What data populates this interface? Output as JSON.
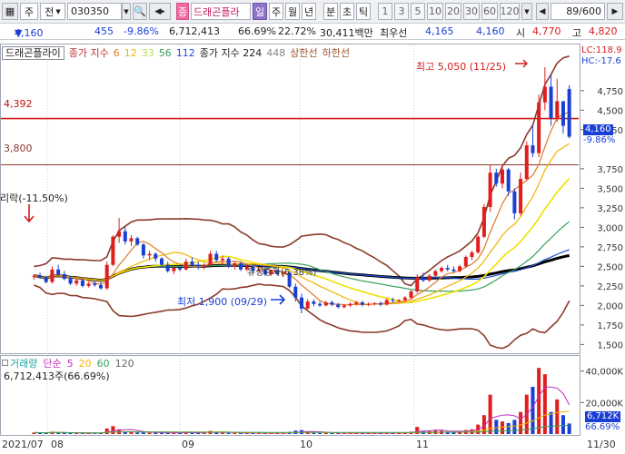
{
  "toolbar": {
    "menu_label": "주",
    "link_label": "전",
    "code": "030350",
    "view_toggle": "종",
    "stock_name": "드래곤플라",
    "day_label": "일",
    "week_label": "주",
    "month_label": "월",
    "year_label": "년",
    "minute_label": "분",
    "second_label": "초",
    "tick_label": "틱",
    "periods": [
      "1",
      "3",
      "5",
      "10",
      "20",
      "30",
      "60",
      "120"
    ],
    "count": "89/600"
  },
  "quote": {
    "price": "4,160",
    "change": "455",
    "change_rate": "-9.86%",
    "volume": "6,712,413",
    "volume_ratio": "66.69%",
    "turnover": "22.72%",
    "amount": "30,411백만",
    "best_label": "최우선",
    "ask": "4,165",
    "bid": "4,160",
    "open_label": "시",
    "open": "4,770",
    "high_label": "고",
    "high": "4,820"
  },
  "legend": {
    "name_box": "드래곤플라이",
    "price_label": "종가 지수",
    "ma": [
      "6",
      "12",
      "33",
      "56",
      "112"
    ],
    "ma_colors": [
      "#e07a2a",
      "#f0b400",
      "#b8e04a",
      "#3aa05a",
      "#1f4fd6"
    ],
    "index_label": "종가 지수",
    "index_val": "224",
    "index_val2": "448",
    "upper": "상한선",
    "lower": "하한선"
  },
  "right_tags": {
    "lc": "LC:118.9",
    "hc": "HC:-17.6",
    "price": "4,160",
    "pct": "-9.86%"
  },
  "levels": {
    "line1": "4,392",
    "line2": "3,800"
  },
  "annotations": {
    "high_text": "최고 5,050 (11/25)",
    "low_text": "최저 1,900 (09/29)",
    "drop_text": "리락(-11.50%)",
    "mid_text": "유상증자(6.38%)"
  },
  "volume_legend": {
    "label": "거래량",
    "simple": "단순",
    "v1": "5",
    "v2": "20",
    "v3": "60",
    "v4": "120",
    "value": "6,712,413주(66.69%)",
    "tag1": "6,712K",
    "tag2": "66.69%"
  },
  "xaxis": {
    "labels": [
      "2021/07",
      "08",
      "09",
      "10",
      "11",
      "11/30"
    ]
  },
  "chart_data": {
    "type": "candlestick",
    "price_axis": {
      "ticks": [
        "4,750",
        "4,500",
        "4,250",
        "3,750",
        "3,500",
        "3,250",
        "3,000",
        "2,750",
        "2,500",
        "2,250",
        "2,000",
        "1,750",
        "1,500"
      ],
      "range": [
        1400,
        5050
      ]
    },
    "volume_axis": {
      "ticks": [
        "40,000K",
        "20,000K"
      ],
      "range": [
        0,
        45000
      ]
    },
    "candles": [
      [
        2370,
        2400,
        2330,
        2380
      ],
      [
        2380,
        2420,
        2340,
        2360
      ],
      [
        2360,
        2380,
        2280,
        2300
      ],
      [
        2300,
        2500,
        2280,
        2460
      ],
      [
        2460,
        2520,
        2380,
        2400
      ],
      [
        2400,
        2440,
        2320,
        2340
      ],
      [
        2340,
        2380,
        2260,
        2280
      ],
      [
        2280,
        2340,
        2250,
        2320
      ],
      [
        2320,
        2340,
        2230,
        2250
      ],
      [
        2250,
        2300,
        2230,
        2280
      ],
      [
        2280,
        2320,
        2240,
        2260
      ],
      [
        2260,
        2300,
        2200,
        2220
      ],
      [
        2220,
        2560,
        2200,
        2520
      ],
      [
        2520,
        2900,
        2500,
        2880
      ],
      [
        2880,
        3120,
        2800,
        2950
      ],
      [
        2950,
        3000,
        2780,
        2820
      ],
      [
        2820,
        2900,
        2760,
        2860
      ],
      [
        2860,
        2880,
        2760,
        2780
      ],
      [
        2780,
        2800,
        2600,
        2640
      ],
      [
        2640,
        2700,
        2580,
        2660
      ],
      [
        2660,
        2680,
        2560,
        2600
      ],
      [
        2600,
        2620,
        2500,
        2520
      ],
      [
        2520,
        2560,
        2420,
        2440
      ],
      [
        2440,
        2500,
        2400,
        2480
      ],
      [
        2480,
        2520,
        2440,
        2460
      ],
      [
        2460,
        2600,
        2450,
        2560
      ],
      [
        2560,
        2620,
        2500,
        2520
      ],
      [
        2520,
        2560,
        2460,
        2500
      ],
      [
        2500,
        2540,
        2460,
        2520
      ],
      [
        2520,
        2700,
        2500,
        2660
      ],
      [
        2660,
        2700,
        2560,
        2580
      ],
      [
        2580,
        2640,
        2520,
        2600
      ],
      [
        2600,
        2620,
        2480,
        2500
      ],
      [
        2500,
        2560,
        2460,
        2540
      ],
      [
        2540,
        2560,
        2440,
        2460
      ],
      [
        2460,
        2520,
        2440,
        2500
      ],
      [
        2500,
        2520,
        2420,
        2440
      ],
      [
        2440,
        2480,
        2420,
        2460
      ],
      [
        2460,
        2480,
        2380,
        2400
      ],
      [
        2400,
        2460,
        2380,
        2450
      ],
      [
        2450,
        2470,
        2380,
        2400
      ],
      [
        2400,
        2440,
        2360,
        2420
      ],
      [
        2420,
        2440,
        2220,
        2240
      ],
      [
        2240,
        2280,
        2050,
        2100
      ],
      [
        2100,
        2150,
        1900,
        1960
      ],
      [
        1960,
        2080,
        1950,
        2050
      ],
      [
        2050,
        2080,
        1990,
        2020
      ],
      [
        2020,
        2050,
        1980,
        2000
      ],
      [
        2000,
        2060,
        1990,
        2040
      ],
      [
        2040,
        2060,
        1990,
        2010
      ],
      [
        2010,
        2030,
        1960,
        1980
      ],
      [
        1980,
        2020,
        1960,
        2000
      ],
      [
        2000,
        2040,
        1980,
        2020
      ],
      [
        2020,
        2060,
        2000,
        2040
      ],
      [
        2040,
        2060,
        1990,
        2010
      ],
      [
        2010,
        2040,
        1990,
        2020
      ],
      [
        2020,
        2040,
        2000,
        2030
      ],
      [
        2030,
        2050,
        1990,
        2010
      ],
      [
        2010,
        2090,
        2000,
        2070
      ],
      [
        2070,
        2100,
        2040,
        2060
      ],
      [
        2060,
        2080,
        2040,
        2070
      ],
      [
        2070,
        2120,
        2050,
        2100
      ],
      [
        2100,
        2200,
        2080,
        2180
      ],
      [
        2180,
        2400,
        2160,
        2360
      ],
      [
        2360,
        2420,
        2300,
        2320
      ],
      [
        2320,
        2400,
        2300,
        2380
      ],
      [
        2380,
        2460,
        2360,
        2440
      ],
      [
        2440,
        2500,
        2420,
        2480
      ],
      [
        2480,
        2520,
        2440,
        2460
      ],
      [
        2460,
        2500,
        2420,
        2440
      ],
      [
        2440,
        2520,
        2420,
        2500
      ],
      [
        2500,
        2640,
        2480,
        2620
      ],
      [
        2620,
        2700,
        2580,
        2680
      ],
      [
        2680,
        2900,
        2660,
        2880
      ],
      [
        2880,
        3300,
        2860,
        3260
      ],
      [
        3260,
        3800,
        3200,
        3700
      ],
      [
        3700,
        3750,
        3520,
        3560
      ],
      [
        3560,
        3800,
        3500,
        3740
      ],
      [
        3740,
        3760,
        3400,
        3460
      ],
      [
        3460,
        3500,
        3100,
        3180
      ],
      [
        3180,
        3700,
        3150,
        3620
      ],
      [
        3620,
        4100,
        3600,
        4050
      ],
      [
        4050,
        4300,
        3900,
        3950
      ],
      [
        3950,
        4700,
        3900,
        4600
      ],
      [
        4600,
        5050,
        4500,
        4800
      ],
      [
        4800,
        4950,
        4300,
        4400
      ],
      [
        4400,
        4900,
        4350,
        4615
      ],
      [
        4615,
        4615,
        4200,
        4300
      ],
      [
        4770,
        4820,
        4140,
        4160
      ]
    ],
    "volumes": [
      900,
      800,
      700,
      1500,
      900,
      700,
      600,
      600,
      500,
      600,
      500,
      600,
      3500,
      5000,
      3000,
      1500,
      1200,
      900,
      1100,
      800,
      900,
      700,
      800,
      600,
      600,
      1500,
      900,
      800,
      700,
      2000,
      900,
      800,
      700,
      800,
      600,
      600,
      600,
      500,
      600,
      600,
      500,
      600,
      1400,
      2200,
      2500,
      1000,
      800,
      700,
      800,
      600,
      600,
      500,
      600,
      700,
      600,
      500,
      600,
      500,
      900,
      700,
      600,
      700,
      1500,
      4500,
      2000,
      1800,
      2500,
      2000,
      1500,
      1200,
      1800,
      2500,
      3000,
      6000,
      12000,
      25000,
      9000,
      8000,
      7000,
      9000,
      14000,
      25000,
      30000,
      42000,
      38000,
      14000,
      22000,
      12000,
      6712
    ]
  }
}
